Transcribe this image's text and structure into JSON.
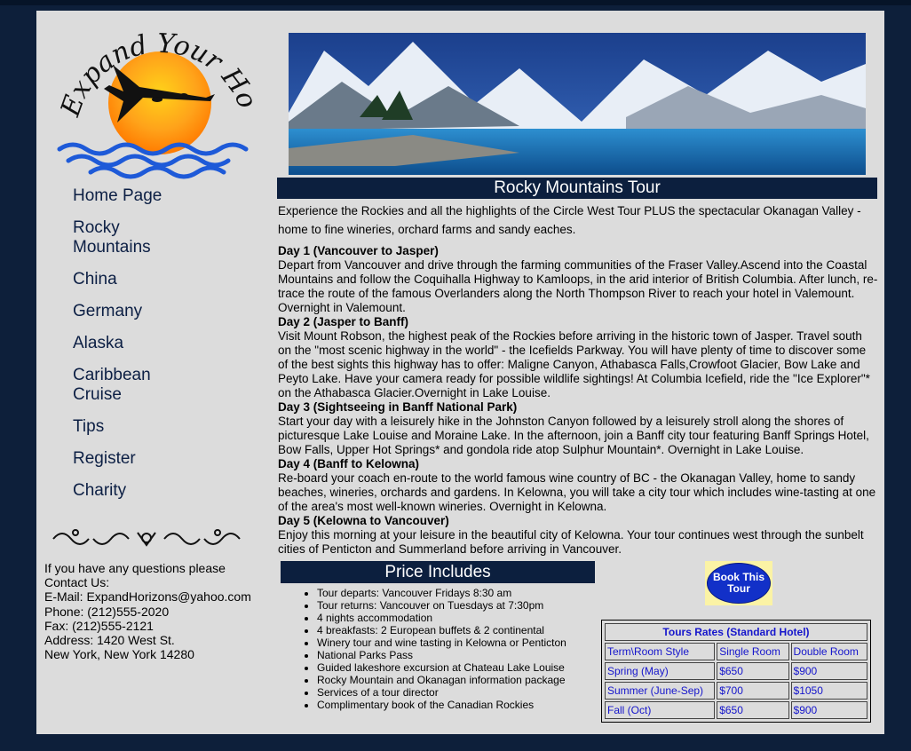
{
  "logo": {
    "text": "Expand Your Horizons"
  },
  "nav": {
    "items": [
      {
        "label": "Home Page"
      },
      {
        "label": "Rocky Mountains"
      },
      {
        "label": "China"
      },
      {
        "label": "Germany"
      },
      {
        "label": "Alaska"
      },
      {
        "label": "Caribbean Cruise"
      },
      {
        "label": "Tips"
      },
      {
        "label": "Register"
      },
      {
        "label": "Charity"
      }
    ]
  },
  "contact": {
    "lines": [
      "If you have any questions please",
      "Contact Us:",
      "E-Mail: ExpandHorizons@yahoo.com",
      "Phone: (212)555-2020",
      "Fax: (212)555-2121",
      "Address: 1420 West St.",
      "New York, New York 14280"
    ]
  },
  "tour": {
    "title": "Rocky Mountains Tour",
    "intro": "Experience the Rockies and all the highlights of the Circle West Tour PLUS the spectacular Okanagan Valley - home to fine wineries, orchard farms and sandy eaches.",
    "days": [
      {
        "heading": "Day 1 (Vancouver to Jasper)",
        "text": "Depart from Vancouver and drive through the farming communities of the Fraser Valley.Ascend into the Coastal Mountains and follow the Coquihalla Highway to Kamloops, in the arid interior of British Columbia. After lunch, re-trace the route of the famous Overlanders along the North Thompson River to reach your hotel in Valemount. Overnight in Valemount."
      },
      {
        "heading": "Day 2 (Jasper to Banff)",
        "text": "Visit Mount Robson, the highest peak of the Rockies before arriving in the historic town of Jasper. Travel south on the \"most scenic highway in the world\" - the Icefields Parkway. You will have plenty of time to discover some of the best sights this highway has to offer: Maligne Canyon, Athabasca Falls,Crowfoot Glacier, Bow Lake and Peyto Lake. Have your camera ready for possible wildlife sightings! At Columbia Icefield, ride the \"Ice Explorer\"* on the Athabasca Glacier.Overnight in Lake Louise."
      },
      {
        "heading": "Day 3 (Sightseeing in Banff National Park)",
        "text": "Start your day with a leisurely hike in the Johnston Canyon followed by a leisurely stroll along the shores of picturesque Lake Louise and Moraine Lake. In the afternoon, join a Banff city tour featuring Banff Springs Hotel, Bow Falls, Upper Hot Springs* and gondola ride atop Sulphur Mountain*. Overnight in Lake Louise."
      },
      {
        "heading": "Day 4 (Banff to Kelowna)",
        "text": "Re-board your coach en-route to the world famous wine country of BC - the Okanagan Valley, home to sandy beaches, wineries, orchards and gardens. In Kelowna, you will take a city tour which includes wine-tasting at one of the area's most well-known wineries. Overnight in Kelowna."
      },
      {
        "heading": "Day 5 (Kelowna to Vancouver)",
        "text": "Enjoy this morning at your leisure in the beautiful city of Kelowna. Your tour continues west through the sunbelt cities of Penticton and Summerland before arriving in Vancouver."
      }
    ]
  },
  "price": {
    "title": "Price Includes",
    "items": [
      "Tour departs: Vancouver Fridays 8:30 am",
      "Tour returns: Vancouver on Tuesdays at 7:30pm",
      "4 nights accommodation",
      "4 breakfasts: 2 European buffets & 2 continental",
      "Winery tour and wine tasting in Kelowna or Penticton",
      "National Parks Pass",
      "Guided lakeshore excursion at Chateau Lake Louise",
      "Rocky Mountain and Okanagan information package",
      "Services of a tour director",
      "Complimentary book of the Canadian Rockies"
    ]
  },
  "book": {
    "label_line1": "Book This",
    "label_line2": "Tour"
  },
  "rates": {
    "caption": "Tours Rates (Standard Hotel)",
    "header": [
      "Term\\Room Style",
      "Single Room",
      "Double Room"
    ],
    "rows": [
      [
        "Spring (May)",
        "$650",
        "$900"
      ],
      [
        "Summer (June-Sep)",
        "$700",
        "$1050"
      ],
      [
        "Fall (Oct)",
        "$650",
        "$900"
      ]
    ]
  }
}
